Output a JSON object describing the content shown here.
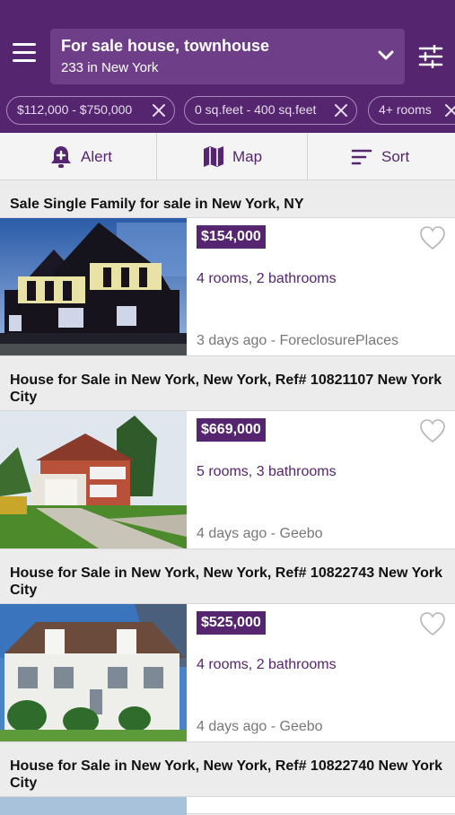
{
  "header": {
    "search_title": "For sale house, townhouse",
    "search_subtitle": "233 in New York",
    "colors": {
      "bar": "#55256f",
      "search_box": "#6e3f88"
    }
  },
  "filters": [
    {
      "label": "$112,000 - $750,000"
    },
    {
      "label": "0 sq.feet - 400 sq.feet"
    },
    {
      "label": "4+ rooms"
    }
  ],
  "actions": {
    "alert_label": "Alert",
    "map_label": "Map",
    "sort_label": "Sort"
  },
  "listings": [
    {
      "title": "Sale Single Family for sale in New York, NY",
      "price": "$154,000",
      "rooms": "4 rooms, 2 bathrooms",
      "meta": "3 days ago - ForeclosurePlaces"
    },
    {
      "title": "House for Sale in New York, New York, Ref# 10821107 New York City",
      "price": "$669,000",
      "rooms": "5 rooms, 3 bathrooms",
      "meta": "4 days ago - Geebo"
    },
    {
      "title": "House for Sale in New York, New York, Ref# 10822743 New York City",
      "price": "$525,000",
      "rooms": "4 rooms, 2 bathrooms",
      "meta": "4 days ago - Geebo"
    },
    {
      "title": "House for Sale in New York, New York, Ref# 10822740 New York City"
    }
  ]
}
